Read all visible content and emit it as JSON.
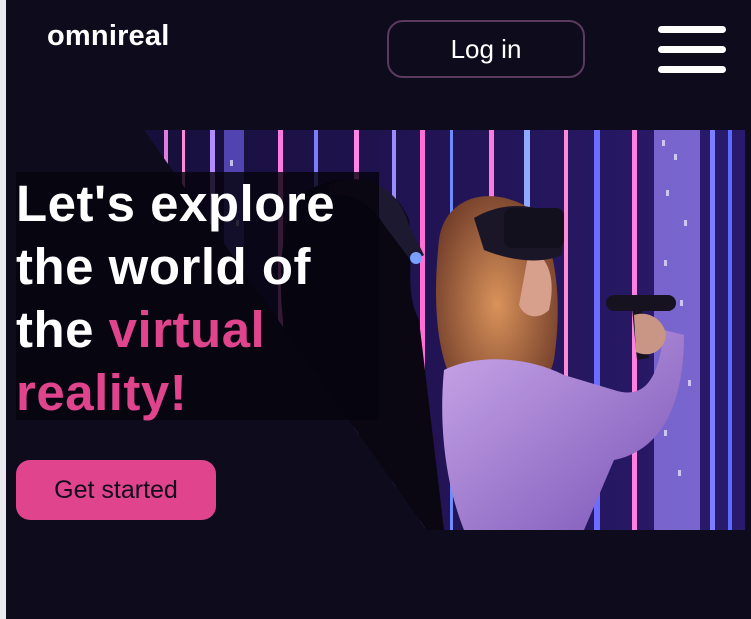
{
  "header": {
    "logo_text": "omnireal",
    "login_label": "Log in",
    "menu_icon": "hamburger-menu-icon"
  },
  "hero": {
    "headline_part1": "Let's explore the world of the ",
    "headline_accent": "virtual reality!",
    "cta_label": "Get started",
    "image_description_icon": "vr-users-photo"
  },
  "colors": {
    "background": "#0d0b1c",
    "accent": "#e0448d",
    "text": "#ffffff",
    "login_border": "#5a3a5f"
  }
}
